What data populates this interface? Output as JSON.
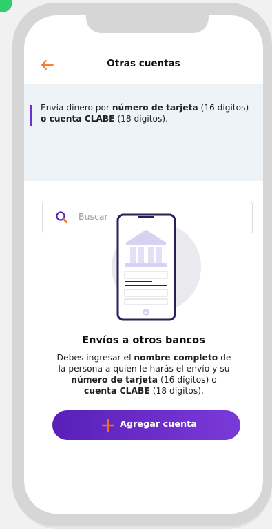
{
  "header": {
    "title": "Otras cuentas",
    "back_icon": "arrow-left-icon"
  },
  "info": {
    "part1": "Envía dinero por ",
    "part2": "número de tarjeta",
    "part3": " (16 dígitos) ",
    "part4": "o cuenta CLABE",
    "part5": " (18 dígitos)."
  },
  "search": {
    "placeholder": "Buscar",
    "icon": "search-icon"
  },
  "empty_state": {
    "title": "Envíos a otros bancos",
    "desc1": "Debes ingresar el ",
    "desc2": "nombre completo",
    "desc3": " de la persona a quien le harás el envío y su ",
    "desc4": "número de tarjeta",
    "desc5": " (16 dígitos) o ",
    "desc6": "cuenta CLABE",
    "desc7": " (18 dígitos).",
    "illustration": "phone-bank-illustration"
  },
  "add_button": {
    "label": "Agregar cuenta",
    "icon": "plus-icon"
  },
  "colors": {
    "brand_purple": "#5a1fb8",
    "accent_orange": "#f26d21",
    "panel_bg": "#eef3f7"
  }
}
